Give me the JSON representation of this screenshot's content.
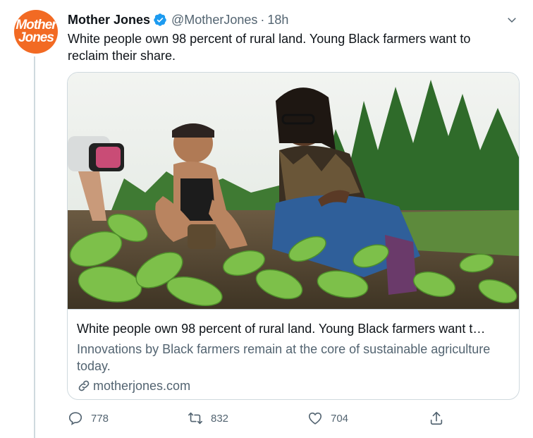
{
  "tweet": {
    "avatar": {
      "line1": "Mother",
      "line2": "Jones",
      "color": "#f26a23"
    },
    "author_name": "Mother Jones",
    "handle": "@MotherJones",
    "separator": "·",
    "time": "18h",
    "text": "White people own 98 percent of rural land. Young Black farmers want to reclaim their share.",
    "verified_icon": "verified-badge-icon",
    "more_icon": "chevron-down-icon"
  },
  "card": {
    "title": "White people own 98 percent of rural land. Young Black farmers want t…",
    "description": "Innovations by Black farmers remain at the core of sustainable agriculture today.",
    "domain": "motherjones.com",
    "link_icon": "link-icon"
  },
  "actions": {
    "reply_count": "778",
    "retweet_count": "832",
    "like_count": "704",
    "icons": [
      "reply-icon",
      "retweet-icon",
      "like-icon",
      "share-icon"
    ]
  },
  "colors": {
    "verified": "#1d9bf0",
    "secondary_text": "#536471",
    "border": "#cfd9de"
  }
}
